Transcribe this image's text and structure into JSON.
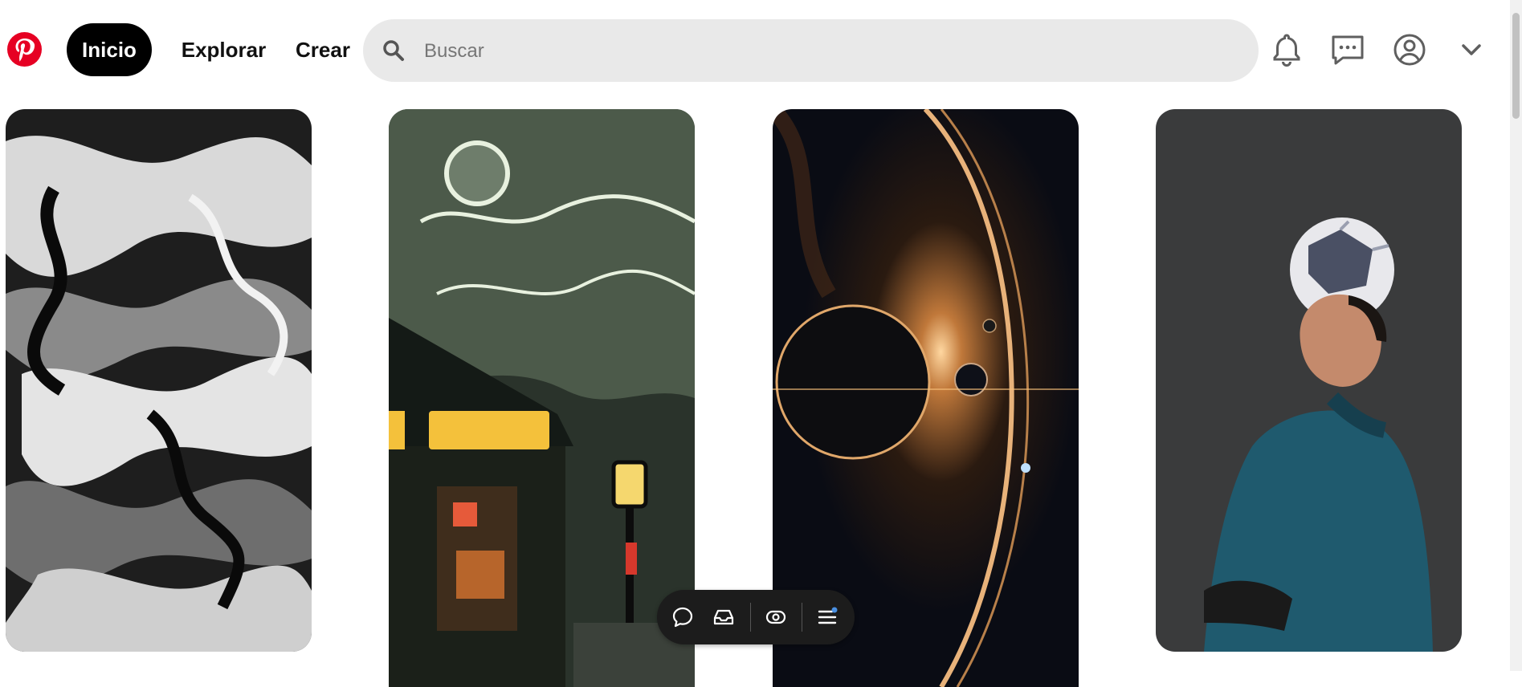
{
  "header": {
    "logo": "pinterest-logo",
    "nav": [
      {
        "label": "Inicio",
        "active": true
      },
      {
        "label": "Explorar",
        "active": false
      },
      {
        "label": "Crear",
        "active": false
      }
    ],
    "search": {
      "placeholder": "Buscar",
      "value": ""
    },
    "icons": [
      "bell-icon",
      "message-icon",
      "profile-icon",
      "chevron-down-icon"
    ]
  },
  "pins": [
    {
      "name": "black-white-marble-art"
    },
    {
      "name": "japanese-night-street"
    },
    {
      "name": "planet-eclipse"
    },
    {
      "name": "football-player-ball-on-head"
    }
  ],
  "floating_toolbar": {
    "icons": [
      "comment-icon",
      "inbox-icon",
      "eye-icon",
      "menu-icon"
    ],
    "has_notification_dot": true
  },
  "colors": {
    "brand": "#e60023",
    "active_nav_bg": "#000000",
    "search_bg": "#e9e9e9",
    "toolbar_bg": "#1c1c1c",
    "notification_dot": "#4a90e2"
  }
}
